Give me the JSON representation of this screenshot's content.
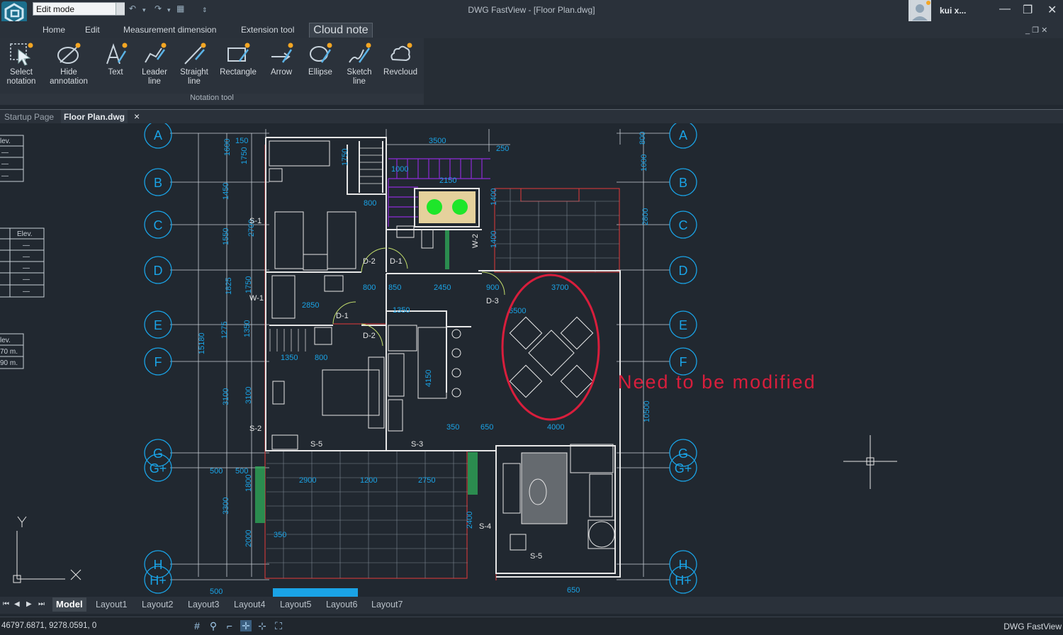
{
  "window": {
    "title": "DWG FastView - [Floor Plan.dwg]",
    "mode_value": "Edit mode",
    "user_name": "kui x..."
  },
  "ribbon_tabs": [
    "Home",
    "Edit",
    "Measurement dimension",
    "Extension tool",
    "Cloud note"
  ],
  "ribbon": {
    "group_label": "Notation tool",
    "buttons": [
      {
        "line1": "Select",
        "line2": "notation",
        "icon": "select-notation-icon"
      },
      {
        "line1": "Hide",
        "line2": "annotation",
        "icon": "hide-annotation-icon"
      },
      {
        "line1": "Text",
        "line2": "",
        "icon": "text-icon"
      },
      {
        "line1": "Leader",
        "line2": "line",
        "icon": "leader-line-icon"
      },
      {
        "line1": "Straight",
        "line2": "line",
        "icon": "straight-line-icon"
      },
      {
        "line1": "Rectangle",
        "line2": "",
        "icon": "rectangle-icon"
      },
      {
        "line1": "Arrow",
        "line2": "",
        "icon": "arrow-icon"
      },
      {
        "line1": "Ellipse",
        "line2": "",
        "icon": "ellipse-icon"
      },
      {
        "line1": "Sketch",
        "line2": "line",
        "icon": "sketch-line-icon"
      },
      {
        "line1": "Revcloud",
        "line2": "",
        "icon": "revcloud-icon"
      }
    ]
  },
  "doc_tabs": {
    "startup": "Startup Page",
    "active": "Floor Plan.dwg",
    "close": "×"
  },
  "drawing": {
    "annotation": "Need to be modified",
    "grid_labels": [
      "A",
      "B",
      "C",
      "D",
      "E",
      "F",
      "G",
      "G+",
      "H",
      "H+"
    ],
    "dims_top": [
      "3500",
      "250",
      "1000",
      "2150",
      "150",
      "1750",
      "1750",
      "800"
    ],
    "dims_left": [
      "1600",
      "1450",
      "2700",
      "1550",
      "1825",
      "1750",
      "1275",
      "1350",
      "15180",
      "3100",
      "3100",
      "500",
      "500",
      "1800",
      "3300",
      "2000",
      "500"
    ],
    "dims_right": [
      "800",
      "1000",
      "2800",
      "10500"
    ],
    "dims_inner": [
      "800",
      "850",
      "2450",
      "900",
      "3700",
      "1350",
      "6500",
      "2850",
      "1350",
      "800",
      "4150",
      "350",
      "650",
      "4000",
      "2900",
      "1200",
      "2750",
      "350",
      "2400",
      "650",
      "1400",
      "1400"
    ],
    "labels": [
      "S-1",
      "W-1",
      "D-2",
      "D-1",
      "W-2",
      "D-3",
      "D-1",
      "D-2",
      "S-2",
      "S-5",
      "S-3",
      "S-4",
      "S-5"
    ],
    "table1": {
      "header": "lev.",
      "rows": [
        "—",
        "—",
        "—"
      ]
    },
    "table2": {
      "header": "Elev.",
      "rows": [
        "—",
        "—",
        "—",
        "—",
        "—",
        "—"
      ]
    },
    "table3": {
      "header": "lev.",
      "rows": [
        "70 m.",
        "90 m."
      ]
    },
    "ucs": {
      "y": "Y",
      "x": "X"
    },
    "colors": {
      "annotation": "#d81e3c",
      "dimension": "#1aa3e6",
      "wall": "#e6e6e6",
      "hatch": "#2fae5a",
      "room_line": "#e53a3a"
    }
  },
  "layout_tabs": [
    "Model",
    "Layout1",
    "Layout2",
    "Layout3",
    "Layout4",
    "Layout5",
    "Layout6",
    "Layout7"
  ],
  "status": {
    "coordinates": "46797.6871, 9278.0591, 0",
    "app_name": "DWG FastView"
  }
}
